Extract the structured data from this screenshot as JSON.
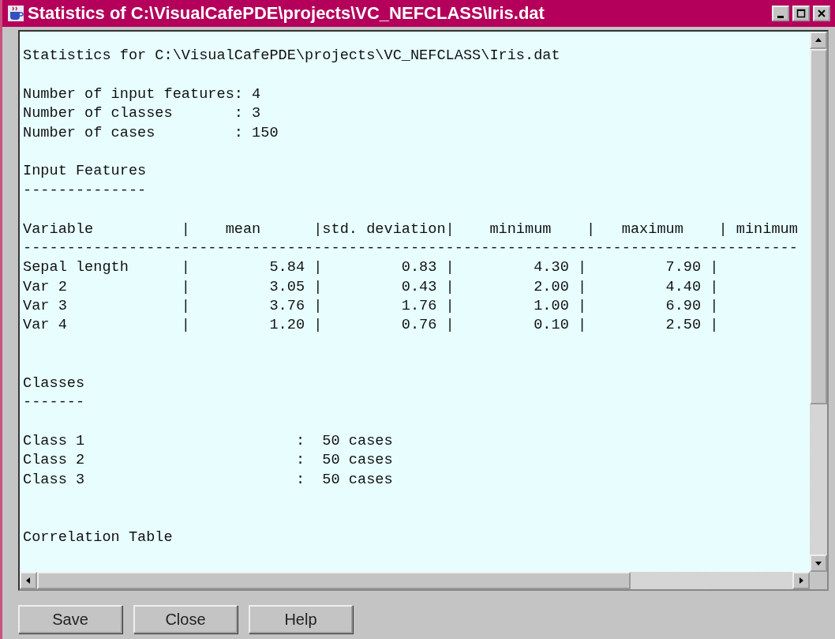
{
  "window": {
    "title": "Statistics of C:\\VisualCafePDE\\projects\\VC_NEFCLASS\\Iris.dat"
  },
  "report": {
    "heading": "Statistics for C:\\VisualCafePDE\\projects\\VC_NEFCLASS\\Iris.dat",
    "counts": [
      "Number of input features: 4",
      "Number of classes       : 3",
      "Number of cases         : 150"
    ],
    "input_features": {
      "title": "Input Features",
      "underline": "--------------",
      "table": {
        "header": "Variable          |    mean      |std. deviation|    minimum    |   maximum    | minimum",
        "rule": "----------------------------------------------------------------------------------------",
        "rows": [
          "Sepal length      |         5.84 |         0.83 |         4.30 |         7.90 |",
          "Var 2             |         3.05 |         0.43 |         2.00 |         4.40 |",
          "Var 3             |         3.76 |         1.76 |         1.00 |         6.90 |",
          "Var 4             |         1.20 |         0.76 |         0.10 |         2.50 |"
        ]
      }
    },
    "classes": {
      "title": "Classes",
      "underline": "-------",
      "rows": [
        "Class 1                        :  50 cases",
        "Class 2                        :  50 cases",
        "Class 3                        :  50 cases"
      ]
    },
    "correlation": {
      "title": "Correlation Table"
    }
  },
  "buttons": [
    "Save",
    "Close",
    "Help"
  ]
}
